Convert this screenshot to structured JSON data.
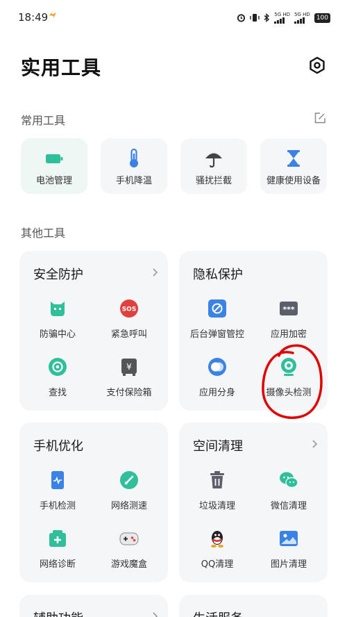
{
  "status_bar": {
    "time": "18:49",
    "sim1_label": "5G HD",
    "sim2_label": "5G HD",
    "battery": "100"
  },
  "header": {
    "title": "实用工具"
  },
  "common_tools": {
    "title": "常用工具",
    "items": [
      {
        "label": "电池管理",
        "icon": "battery-icon"
      },
      {
        "label": "手机降温",
        "icon": "thermometer-icon"
      },
      {
        "label": "骚扰拦截",
        "icon": "umbrella-icon"
      },
      {
        "label": "健康使用设备",
        "icon": "hourglass-icon"
      }
    ]
  },
  "other_tools": {
    "title": "其他工具",
    "cards": [
      {
        "title": "安全防护",
        "items": [
          {
            "label": "防骗中心",
            "icon": "shield-face-icon"
          },
          {
            "label": "紧急呼叫",
            "icon": "sos-icon"
          },
          {
            "label": "查找",
            "icon": "find-device-icon"
          },
          {
            "label": "支付保险箱",
            "icon": "safe-box-icon"
          }
        ]
      },
      {
        "title": "隐私保护",
        "items": [
          {
            "label": "后台弹窗管控",
            "icon": "popup-block-icon"
          },
          {
            "label": "应用加密",
            "icon": "password-icon"
          },
          {
            "label": "应用分身",
            "icon": "app-clone-icon"
          },
          {
            "label": "摄像头检测",
            "icon": "camera-icon"
          }
        ]
      },
      {
        "title": "手机优化",
        "items": [
          {
            "label": "手机检测",
            "icon": "phone-check-icon"
          },
          {
            "label": "网络测速",
            "icon": "speedometer-icon"
          },
          {
            "label": "网络诊断",
            "icon": "network-diagnose-icon"
          },
          {
            "label": "游戏魔盒",
            "icon": "gamepad-icon"
          }
        ]
      },
      {
        "title": "空间清理",
        "items": [
          {
            "label": "垃圾清理",
            "icon": "trash-icon"
          },
          {
            "label": "微信清理",
            "icon": "wechat-icon"
          },
          {
            "label": "QQ清理",
            "icon": "qq-icon"
          },
          {
            "label": "图片清理",
            "icon": "picture-icon"
          }
        ]
      },
      {
        "title": "辅助功能"
      },
      {
        "title": "生活服务"
      }
    ]
  },
  "colors": {
    "accent_green": "#2fbf9b",
    "blue": "#3b82e6",
    "red": "#e0413d",
    "annotation_red": "#e00000"
  }
}
